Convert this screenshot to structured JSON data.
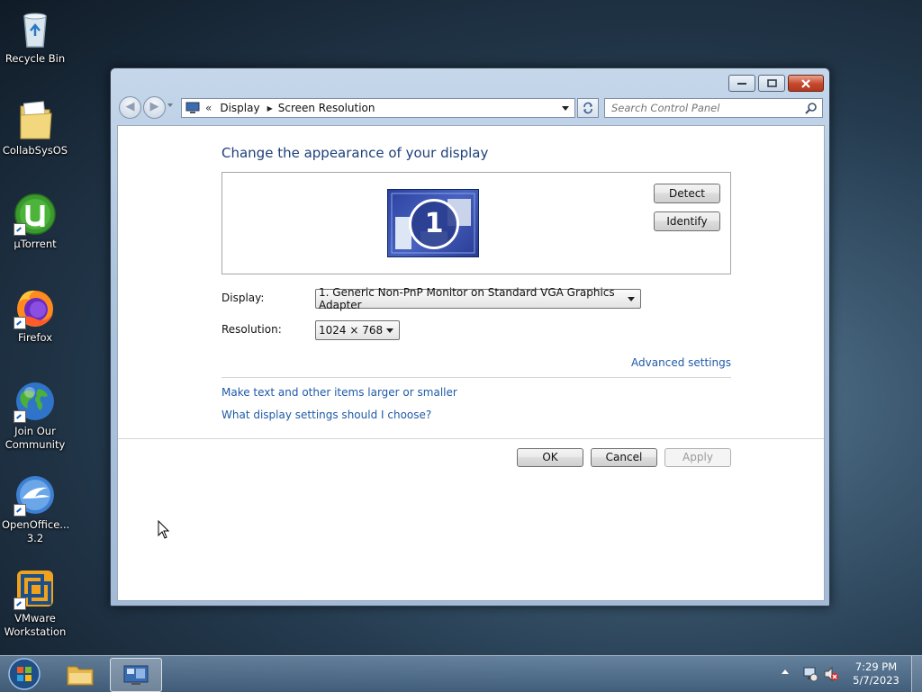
{
  "desktop": {
    "icons": [
      {
        "label": "Recycle Bin"
      },
      {
        "label": "CollabSysOS"
      },
      {
        "label": "µTorrent"
      },
      {
        "label": "Firefox"
      },
      {
        "label": "Join Our Community"
      },
      {
        "label": "OpenOffice... 3.2"
      },
      {
        "label": "VMware Workstation"
      }
    ]
  },
  "window": {
    "breadcrumb": {
      "overflow": "«",
      "parent": "Display",
      "current": "Screen Resolution"
    },
    "search": {
      "placeholder": "Search Control Panel"
    },
    "heading": "Change the appearance of your display",
    "monitor_number": "1",
    "detect_label": "Detect",
    "identify_label": "Identify",
    "display_label": "Display:",
    "display_value": "1. Generic Non-PnP Monitor on Standard VGA Graphics Adapter",
    "resolution_label": "Resolution:",
    "resolution_value": "1024 × 768",
    "advanced_link": "Advanced settings",
    "text_size_link": "Make text and other items larger or smaller",
    "help_link": "What display settings should I choose?",
    "ok_label": "OK",
    "cancel_label": "Cancel",
    "apply_label": "Apply"
  },
  "taskbar": {
    "time": "7:29 PM",
    "date": "5/7/2023"
  },
  "colors": {
    "link": "#1e5aa8",
    "heading": "#1e3f7a",
    "monitor_blue": "#3a4fa8"
  }
}
